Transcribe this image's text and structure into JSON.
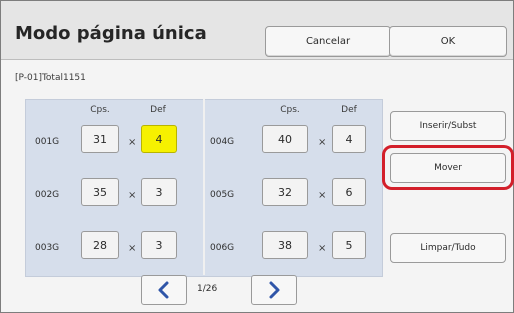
{
  "window": {
    "title": "Modo página única"
  },
  "header": {
    "cancel_label": "Cancelar",
    "ok_label": "OK"
  },
  "subtitle": "[P-01]Total1151",
  "columns": {
    "left": {
      "cps": "Cps.",
      "def": "Def"
    },
    "right": {
      "cps": "Cps.",
      "def": "Def"
    }
  },
  "rows": [
    {
      "label": "001G",
      "cps": "31",
      "def": "4"
    },
    {
      "label": "002G",
      "cps": "35",
      "def": "3"
    },
    {
      "label": "003G",
      "cps": "28",
      "def": "3"
    }
  ],
  "rows_right": [
    {
      "label": "004G",
      "cps": "40",
      "def": "4"
    },
    {
      "label": "005G",
      "cps": "32",
      "def": "6"
    },
    {
      "label": "006G",
      "cps": "38",
      "def": "5"
    }
  ],
  "operators": {
    "times": "×"
  },
  "sidebar": {
    "insert_label": "Inserir/Subst",
    "move_label": "Mover",
    "clear_label": "Limpar/Tudo"
  },
  "pagination": {
    "current": "1/26"
  },
  "icons": {
    "prev": "chevron-left-icon",
    "next": "chevron-right-icon"
  },
  "colors": {
    "accent_yellow": "#f6f100",
    "highlight_red": "#d31f2a",
    "nav_blue": "#2f55a8"
  }
}
